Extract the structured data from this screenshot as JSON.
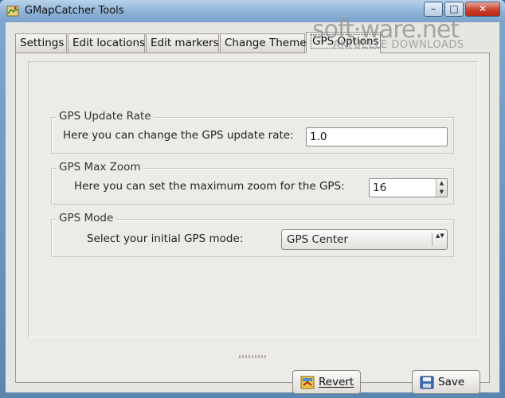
{
  "window": {
    "title": "GMapCatcher Tools",
    "min_glyph": "–",
    "max_glyph": "□",
    "close_glyph": "✕"
  },
  "tabs": [
    {
      "label": "Settings"
    },
    {
      "label": "Edit locations"
    },
    {
      "label": "Edit markers"
    },
    {
      "label": "Change Theme"
    },
    {
      "label": "GPS Options",
      "active": true
    }
  ],
  "gps_update_rate": {
    "title": "GPS Update Rate",
    "label": "Here you can change the GPS update rate:",
    "value": "1.0"
  },
  "gps_max_zoom": {
    "title": "GPS Max Zoom",
    "label": "Here you can set the maximum zoom for the GPS:",
    "value": "16",
    "up_glyph": "▲",
    "down_glyph": "▼"
  },
  "gps_mode": {
    "title": "GPS Mode",
    "label": "Select your initial GPS mode:",
    "selected": "GPS Center",
    "arrow_glyph": "▲▼"
  },
  "buttons": {
    "revert": "Revert",
    "save": "Save"
  },
  "watermark": {
    "main": "soft·ware.net",
    "sub": "AKTUELLE DOWNLOADS"
  },
  "colors": {
    "accent_title": "#8db1d6",
    "close": "#c8402b",
    "panel": "#edebe8"
  }
}
